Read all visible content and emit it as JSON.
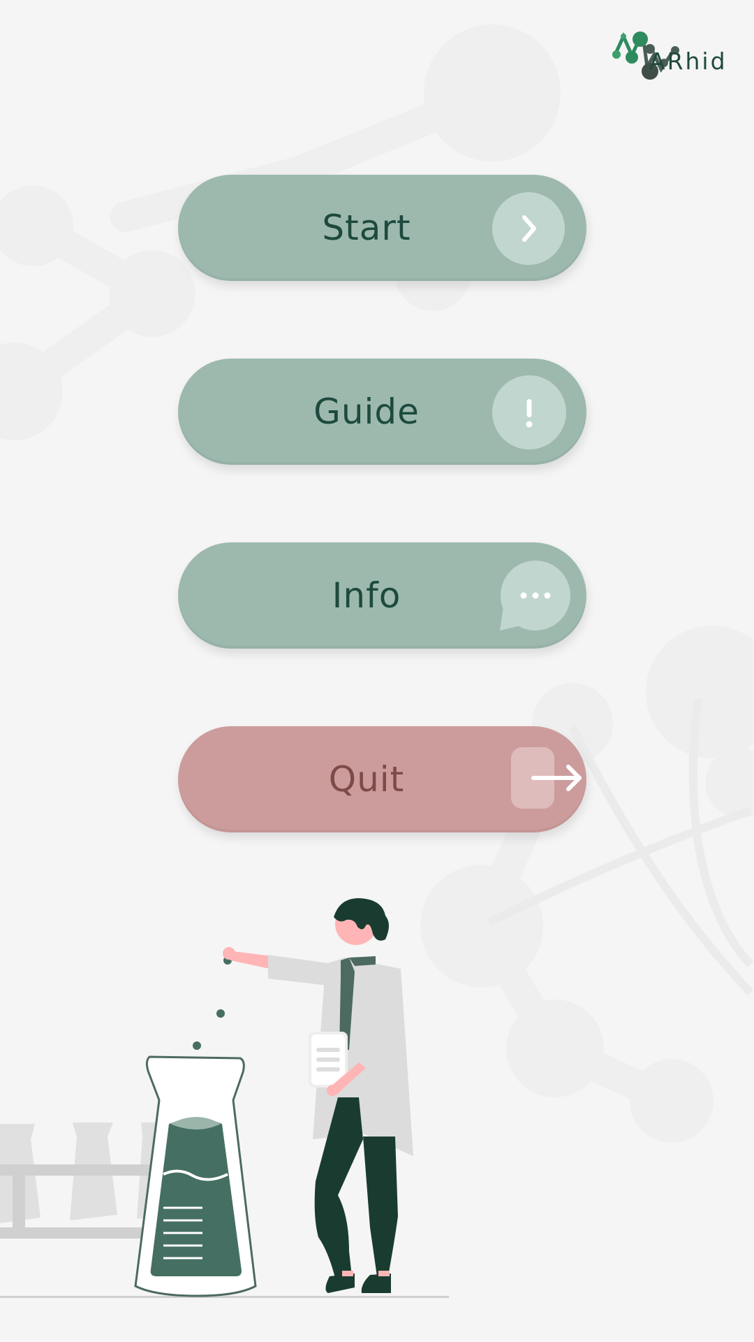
{
  "app": {
    "logo_text": "ARhid"
  },
  "menu": {
    "start": {
      "label": "Start",
      "icon": "chevron-right-icon"
    },
    "guide": {
      "label": "Guide",
      "icon": "exclamation-icon"
    },
    "info": {
      "label": "Info",
      "icon": "speech-bubble-icon"
    },
    "quit": {
      "label": "Quit",
      "icon": "exit-arrow-icon"
    }
  },
  "colors": {
    "background": "#f5f5f5",
    "button_green": "#9db9ae",
    "button_red": "#cc9c9c",
    "text_green": "#1e4a3e",
    "text_red": "#7c4b48",
    "accent_dark": "#1a3c30"
  }
}
